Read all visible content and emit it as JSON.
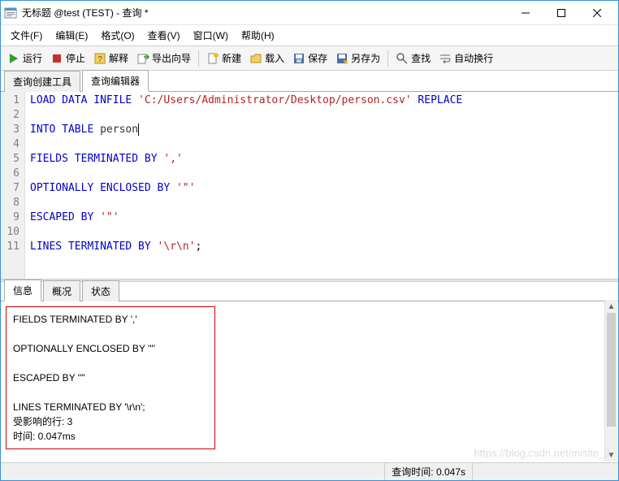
{
  "titlebar": {
    "title": "无标题 @test (TEST) - 查询 *"
  },
  "menu": {
    "file": "文件(F)",
    "edit": "编辑(E)",
    "format": "格式(O)",
    "view": "查看(V)",
    "window": "窗口(W)",
    "help": "帮助(H)"
  },
  "toolbar": {
    "run": "运行",
    "stop": "停止",
    "explain": "解释",
    "export_wizard": "导出向导",
    "new": "新建",
    "load": "载入",
    "save": "保存",
    "save_as": "另存为",
    "find": "查找",
    "wrap": "自动换行"
  },
  "tabs": {
    "builder": "查询创建工具",
    "editor": "查询编辑器"
  },
  "code": {
    "lines": [
      "1",
      "2",
      "3",
      "4",
      "5",
      "6",
      "7",
      "8",
      "9",
      "10",
      "11"
    ],
    "l1_kw1": "LOAD DATA INFILE ",
    "l1_str": "'C:/Users/Administrator/Desktop/person.csv'",
    "l1_kw2": " REPLACE",
    "l3_kw": "INTO TABLE ",
    "l3_ident": "person",
    "l5_kw": "FIELDS TERMINATED BY ",
    "l5_str": "','",
    "l7_kw": "OPTIONALLY ENCLOSED BY ",
    "l7_str": "'\"'",
    "l9_kw": "ESCAPED BY ",
    "l9_str": "'\"'",
    "l11_kw": "LINES TERMINATED BY ",
    "l11_str": "'\\r\\n'",
    "l11_tail": ";"
  },
  "lower_tabs": {
    "info": "信息",
    "profile": "概况",
    "status": "状态"
  },
  "messages": {
    "l1": "FIELDS TERMINATED BY ','",
    "l2": "OPTIONALLY ENCLOSED BY '\"'",
    "l3": "ESCAPED BY '\"'",
    "l4": "LINES TERMINATED BY '\\r\\n';",
    "l5": "受影响的行: 3",
    "l6": "时间: 0.047ms"
  },
  "status": {
    "query_time": "查询时间: 0.047s"
  },
  "watermark": "https://blog.csdn.net/misite_J"
}
